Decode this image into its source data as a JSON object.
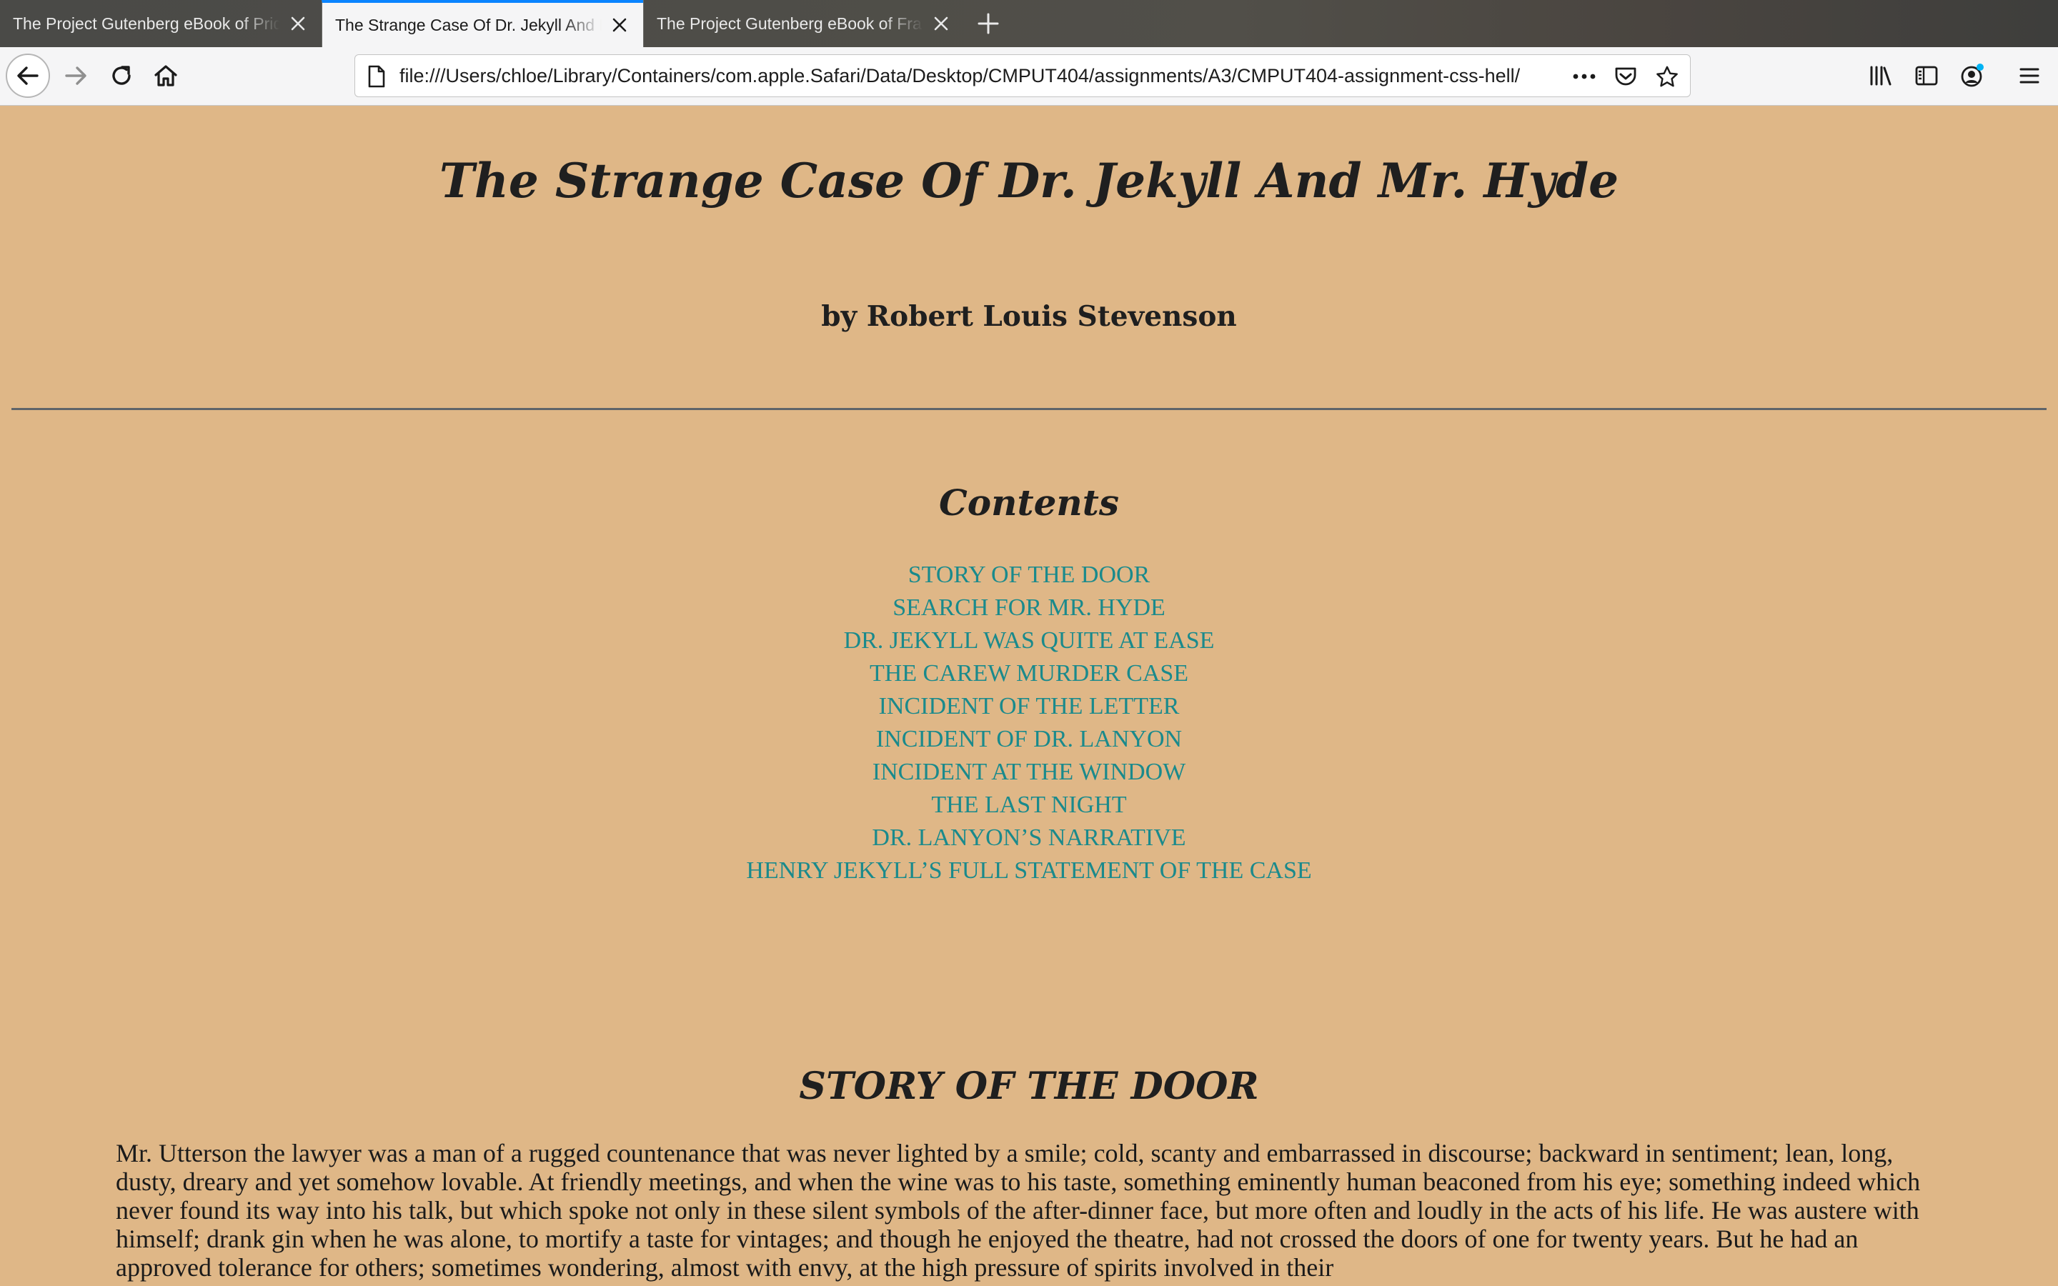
{
  "browser": {
    "tabs": [
      {
        "title": "The Project Gutenberg eBook of Pride and Prejudice",
        "active": false
      },
      {
        "title": "The Strange Case Of Dr. Jekyll And Mr. Hyde",
        "active": true
      },
      {
        "title": "The Project Gutenberg eBook of Frankenstein",
        "active": false
      }
    ],
    "url": "file:///Users/chloe/Library/Containers/com.apple.Safari/Data/Desktop/CMPUT404/assignments/A3/CMPUT404-assignment-css-hell/",
    "accent_color": "#0a84ff",
    "icons": [
      "back-arrow-icon",
      "forward-arrow-icon",
      "reload-icon",
      "home-icon",
      "page-icon",
      "more-actions-icon",
      "pocket-icon",
      "bookmark-star-icon",
      "library-icon",
      "sidebar-icon",
      "account-icon",
      "menu-icon",
      "close-icon",
      "plus-icon"
    ]
  },
  "page": {
    "background_color": "#dfb787",
    "link_color": "#1a8a8c",
    "title": "The Strange Case Of Dr. Jekyll And Mr. Hyde",
    "author": "by Robert Louis Stevenson",
    "contents_heading": "Contents",
    "toc": [
      "STORY OF THE DOOR",
      "SEARCH FOR MR. HYDE",
      "DR. JEKYLL WAS QUITE AT EASE",
      "THE CAREW MURDER CASE",
      "INCIDENT OF THE LETTER",
      "INCIDENT OF DR. LANYON",
      "INCIDENT AT THE WINDOW",
      "THE LAST NIGHT",
      "DR. LANYON’S NARRATIVE",
      "HENRY JEKYLL’S FULL STATEMENT OF THE CASE"
    ],
    "chapter_heading": "STORY OF THE DOOR",
    "paragraph": "Mr. Utterson the lawyer was a man of a rugged countenance that was never lighted by a smile; cold, scanty and embarrassed in discourse; backward in sentiment; lean, long, dusty, dreary and yet somehow lovable. At friendly meetings, and when the wine was to his taste, something eminently human beaconed from his eye; something indeed which never found its way into his talk, but which spoke not only in these silent symbols of the after-dinner face, but more often and loudly in the acts of his life. He was austere with himself; drank gin when he was alone, to mortify a taste for vintages; and though he enjoyed the theatre, had not crossed the doors of one for twenty years. But he had an approved tolerance for others; sometimes wondering, almost with envy, at the high pressure of spirits involved in their"
  }
}
